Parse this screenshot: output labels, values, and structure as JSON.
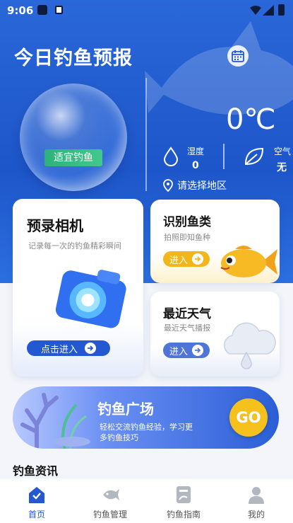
{
  "status_bar": {
    "time": "9:06"
  },
  "header": {
    "title": "今日钓鱼预报"
  },
  "weather": {
    "suitability": "适宜钓鱼",
    "temperature": "0℃",
    "humidity_label": "湿度",
    "humidity_value": "0",
    "air_label": "空气",
    "air_value": "无",
    "region_prompt": "请选择地区"
  },
  "cards": {
    "camera": {
      "title": "预录相机",
      "subtitle": "记录每一次的钓鱼精彩瞬间",
      "button": "点击进入"
    },
    "identify": {
      "title": "识别鱼类",
      "subtitle": "拍照即知鱼种",
      "button": "进入"
    },
    "recent_weather": {
      "title": "最近天气",
      "subtitle": "最近天气播报",
      "button": "进入"
    }
  },
  "banner": {
    "title": "钓鱼广场",
    "subtitle_line1": "轻松交流钓鱼经验，学习更",
    "subtitle_line2": "多钓鱼技巧",
    "go": "GO"
  },
  "section": {
    "title": "钓鱼资讯"
  },
  "nav": {
    "items": [
      {
        "label": "首页",
        "icon": "home-icon",
        "active": true
      },
      {
        "label": "钓鱼管理",
        "icon": "fish-icon",
        "active": false
      },
      {
        "label": "钓鱼指南",
        "icon": "guide-book-icon",
        "active": false
      },
      {
        "label": "我的",
        "icon": "profile-icon",
        "active": false
      }
    ]
  },
  "colors": {
    "primary": "#2458d3",
    "ribbon_green": "#2db27a",
    "identify_button": "#f2b61b",
    "go_button": "#f5c11d"
  }
}
